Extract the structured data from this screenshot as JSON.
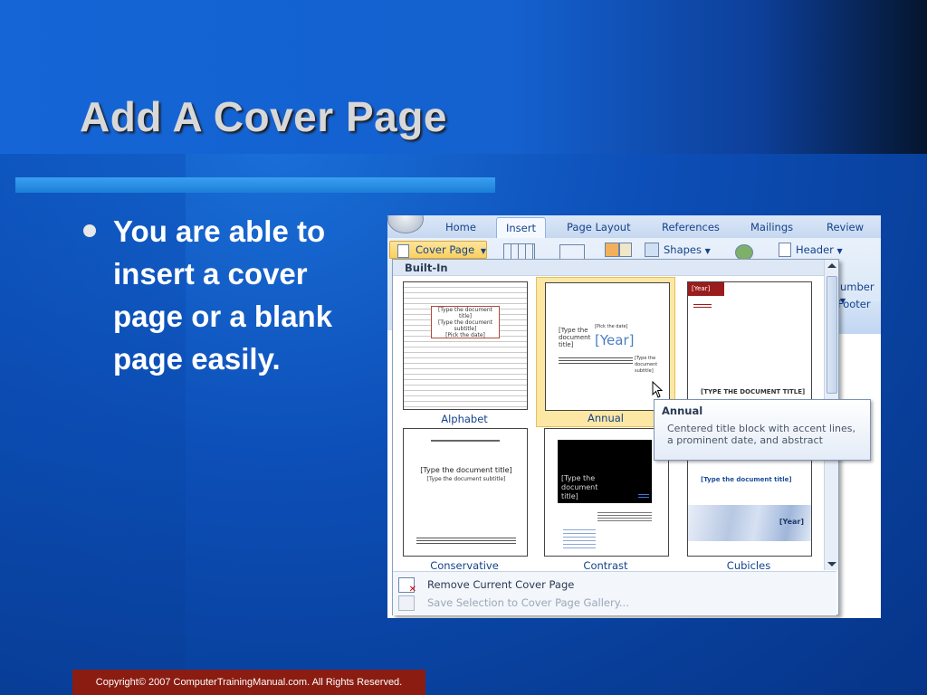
{
  "slide": {
    "title": "Add A Cover Page",
    "bullet": "You are able to insert a cover page or a blank page easily.",
    "footer": "Copyright© 2007 ComputerTrainingManual.com. All Rights Reserved."
  },
  "ribbon": {
    "tabs": [
      "Home",
      "Insert",
      "Page Layout",
      "References",
      "Mailings",
      "Review"
    ],
    "active_tab": "Insert",
    "cover_page_button": "Cover Page",
    "shapes_button": "Shapes",
    "header_button": "Header",
    "number_fragment": "umber",
    "footer_fragment": "Footer"
  },
  "gallery": {
    "section_header": "Built-In",
    "items": [
      {
        "label": "Alphabet",
        "selected": false
      },
      {
        "label": "Annual",
        "selected": true
      },
      {
        "label": "",
        "selected": false
      },
      {
        "label": "Conservative",
        "selected": false
      },
      {
        "label": "Contrast",
        "selected": false
      },
      {
        "label": "Cubicles",
        "selected": false
      }
    ],
    "thumb_text": {
      "alphabet_title": "[Type the document title]",
      "alphabet_sub": "[Type the document subtitle]",
      "alphabet_author": "[Pick the date]",
      "annual_title": "[Type the document title]",
      "annual_year": "[Year]",
      "annual_date": "[Pick the date]",
      "annual_side": "[Type the document subtitle]",
      "third_year": "[Year]",
      "third_title": "[TYPE THE DOCUMENT TITLE]",
      "conservative_title": "[Type the document title]",
      "conservative_sub": "[Type the document subtitle]",
      "contrast_title": "[Type the document title]",
      "cubicles_title": "[Type the document title]",
      "cubicles_year": "[Year]"
    },
    "menu": [
      {
        "label": "Remove Current Cover Page",
        "enabled": true
      },
      {
        "label": "Save Selection to Cover Page Gallery...",
        "enabled": false
      }
    ]
  },
  "tooltip": {
    "title": "Annual",
    "description": "Centered title block with accent lines, a prominent date, and abstract"
  },
  "colors": {
    "background": "#0d4fb8",
    "title_text": "#d8d8d8",
    "rule": "#2b8de4",
    "footer_bg": "#8a1c12",
    "ribbon_text": "#15428b",
    "selection": "#fde7a4",
    "third_accent": "#9b1c1c"
  }
}
